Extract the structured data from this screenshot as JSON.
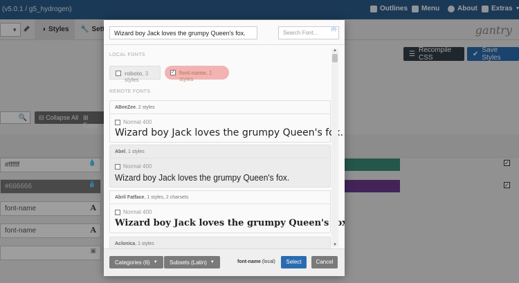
{
  "app": {
    "version": "(v5.0.1 / g5_hydrogen)",
    "menu": {
      "outlines": "Outlines",
      "menu": "Menu",
      "about": "About",
      "extras": "Extras"
    },
    "tabs": {
      "styles": "Styles",
      "settings": "Setti"
    },
    "logo": "gantry",
    "buttons": {
      "recompile": "Recompile CSS",
      "save": "Save Styles",
      "collapse_all": "Collapse All",
      "expand": "Expa"
    },
    "fields": [
      {
        "value": "#ffffff",
        "icon": "droplet-icon"
      },
      {
        "value": "#666666",
        "icon": "droplet-icon"
      },
      {
        "value": "font-name",
        "icon": "A"
      },
      {
        "value": "font-name",
        "icon": "A"
      }
    ],
    "swatch_colors": {
      "green": "#3a8c78",
      "purple": "#6b3a8e"
    }
  },
  "modal": {
    "preview_text": "Wizard boy Jack loves the grumpy Queen's fox.",
    "search_placeholder": "Search Font...",
    "local_fonts_title": "LOCAL FONTS",
    "remote_fonts_title": "REMOTE FONTS",
    "local_fonts": [
      {
        "name": "roboto",
        "meta": ", 3 styles",
        "checked": false
      },
      {
        "name": "font-name",
        "meta": ", 1 styles",
        "checked": true
      }
    ],
    "remote_fonts": [
      {
        "name": "ABeeZee",
        "meta": ", 2 styles",
        "variant": "Normal 400",
        "sample": "Wizard boy Jack loves the grumpy Queen's fox."
      },
      {
        "name": "Abel",
        "meta": ", 1 styles",
        "variant": "Normal 400",
        "sample": "Wizard boy Jack loves the grumpy Queen's fox."
      },
      {
        "name": "Abril Fatface",
        "meta": ", 1 styles, 2 charsets",
        "variant": "Normal 400",
        "sample": "Wizard boy Jack loves the grumpy Queen's fox."
      },
      {
        "name": "Aclonica",
        "meta": ", 1 styles"
      }
    ],
    "footer": {
      "categories": "Categories (6)",
      "subsets": "Subsets (Latin)",
      "selected_font": "font-name",
      "selected_source": " (local)",
      "select": "Select",
      "cancel": "Cancel"
    }
  }
}
